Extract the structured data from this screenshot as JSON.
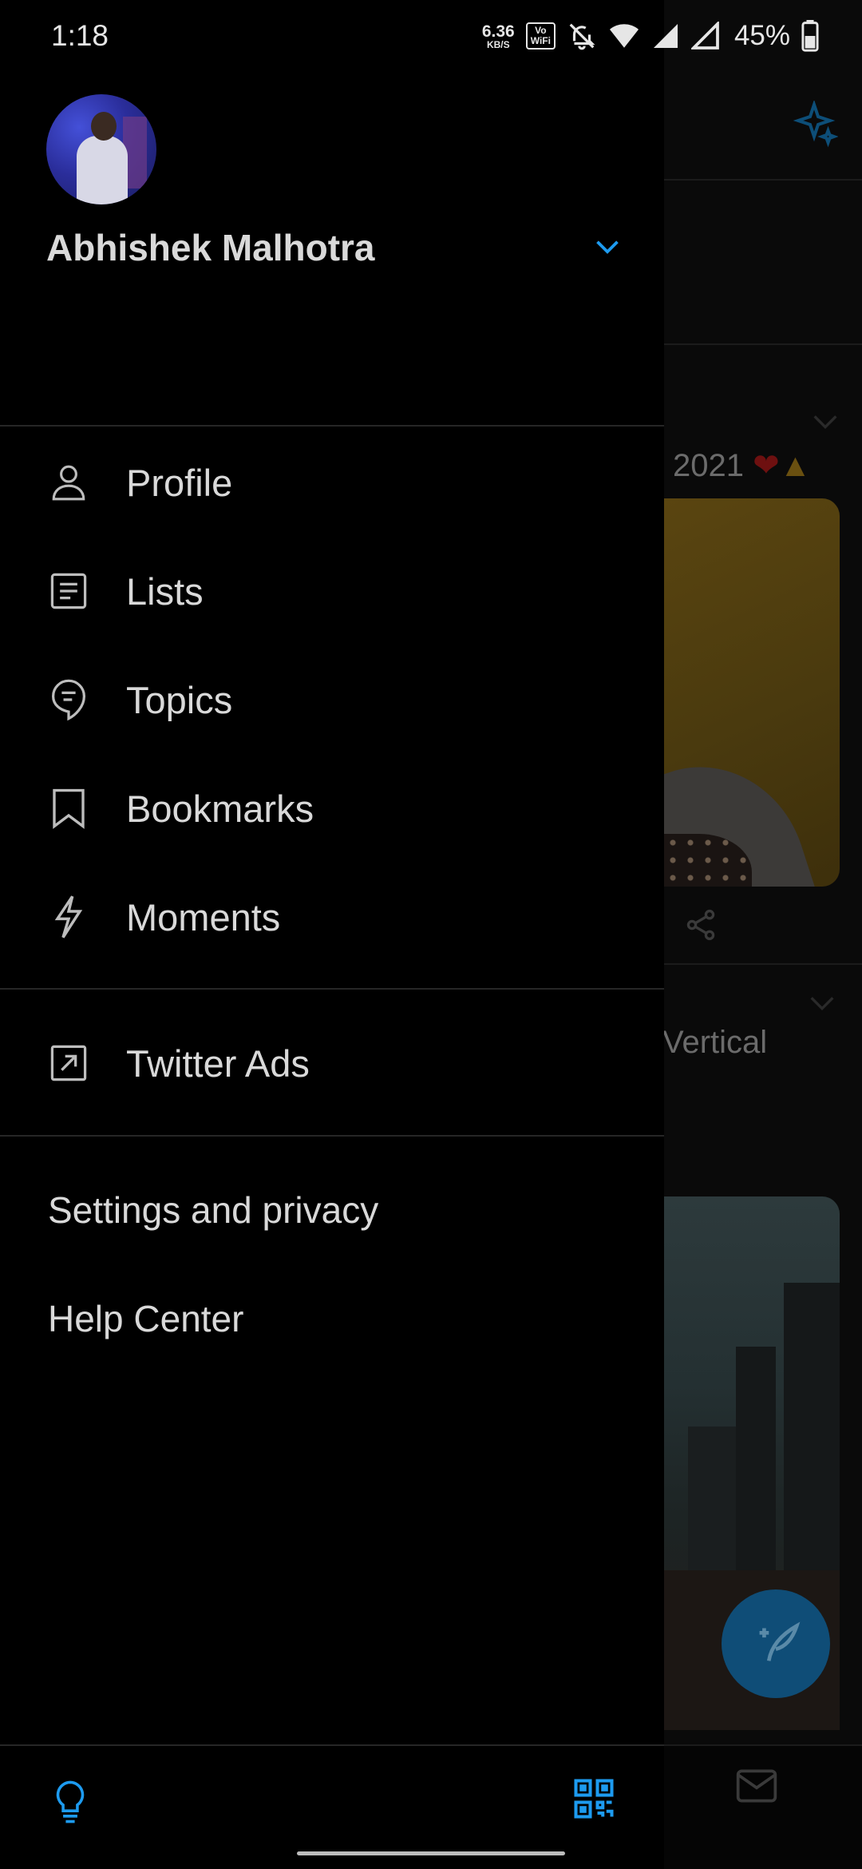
{
  "status_bar": {
    "time": "1:18",
    "net_speed_value": "6.36",
    "net_speed_unit": "KB/S",
    "volte_top": "Vo",
    "volte_bottom": "WiFi",
    "battery_percent": "45%"
  },
  "drawer": {
    "account_name": "Abhishek Malhotra",
    "primary_menu": [
      {
        "label": "Profile",
        "icon": "person-icon"
      },
      {
        "label": "Lists",
        "icon": "lists-icon"
      },
      {
        "label": "Topics",
        "icon": "topics-icon"
      },
      {
        "label": "Bookmarks",
        "icon": "bookmark-icon"
      },
      {
        "label": "Moments",
        "icon": "moments-icon"
      }
    ],
    "ads_item": {
      "label": "Twitter Ads",
      "icon": "external-link-icon"
    },
    "settings_label": "Settings and privacy",
    "help_label": "Help Center",
    "footer": {
      "left_icon": "lightbulb-icon",
      "right_icon": "qr-code-icon"
    }
  },
  "feed_background": {
    "tweet_date_text": "2021",
    "tweet_text_2": "Vertical",
    "top_icon": "sparkle-icon",
    "fab_icon": "compose-tweet-icon",
    "nav_icon": "mail-icon"
  },
  "colors": {
    "accent": "#1d9bf0",
    "background": "#000000",
    "text": "#d9d9d9",
    "divider": "#262626"
  }
}
